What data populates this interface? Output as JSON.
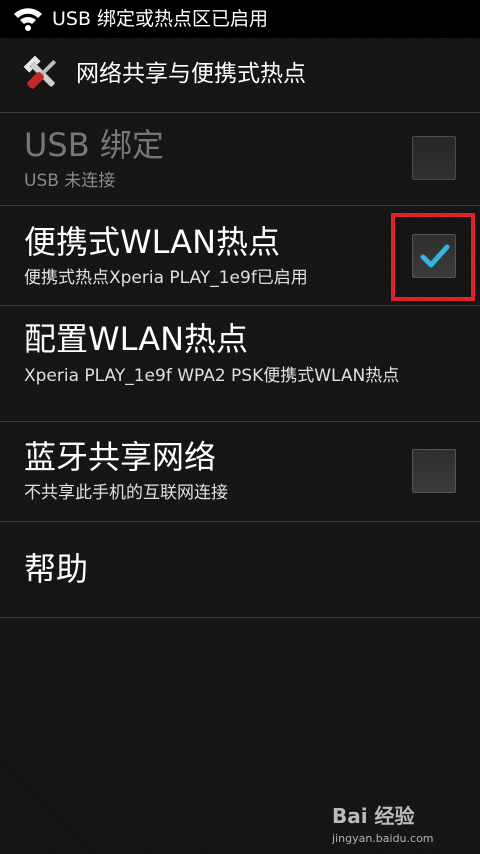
{
  "status_bar": {
    "icon": "wifi-hotspot-icon",
    "text": "USB 绑定或热点区已启用"
  },
  "action_bar": {
    "icon": "tools-icon",
    "title": "网络共享与便携式热点"
  },
  "items": [
    {
      "title": "USB 绑定",
      "subtitle": "USB 未连接",
      "has_checkbox": true,
      "checked": false,
      "enabled": false
    },
    {
      "title": "便携式WLAN热点",
      "subtitle": "便携式热点Xperia PLAY_1e9f已启用",
      "has_checkbox": true,
      "checked": true,
      "enabled": true
    },
    {
      "title": "配置WLAN热点",
      "subtitle": "Xperia PLAY_1e9f WPA2 PSK便携式WLAN热点",
      "has_checkbox": false,
      "enabled": true
    },
    {
      "title": "蓝牙共享网络",
      "subtitle": "不共享此手机的互联网连接",
      "has_checkbox": true,
      "checked": false,
      "enabled": true
    },
    {
      "title": "帮助",
      "has_checkbox": false,
      "enabled": true
    }
  ],
  "colors": {
    "background": "#141414",
    "check_accent": "#33b5e5",
    "highlight": "#e0232a"
  },
  "watermark": {
    "logo": "Bai 经验",
    "url": "jingyan.baidu.com"
  }
}
